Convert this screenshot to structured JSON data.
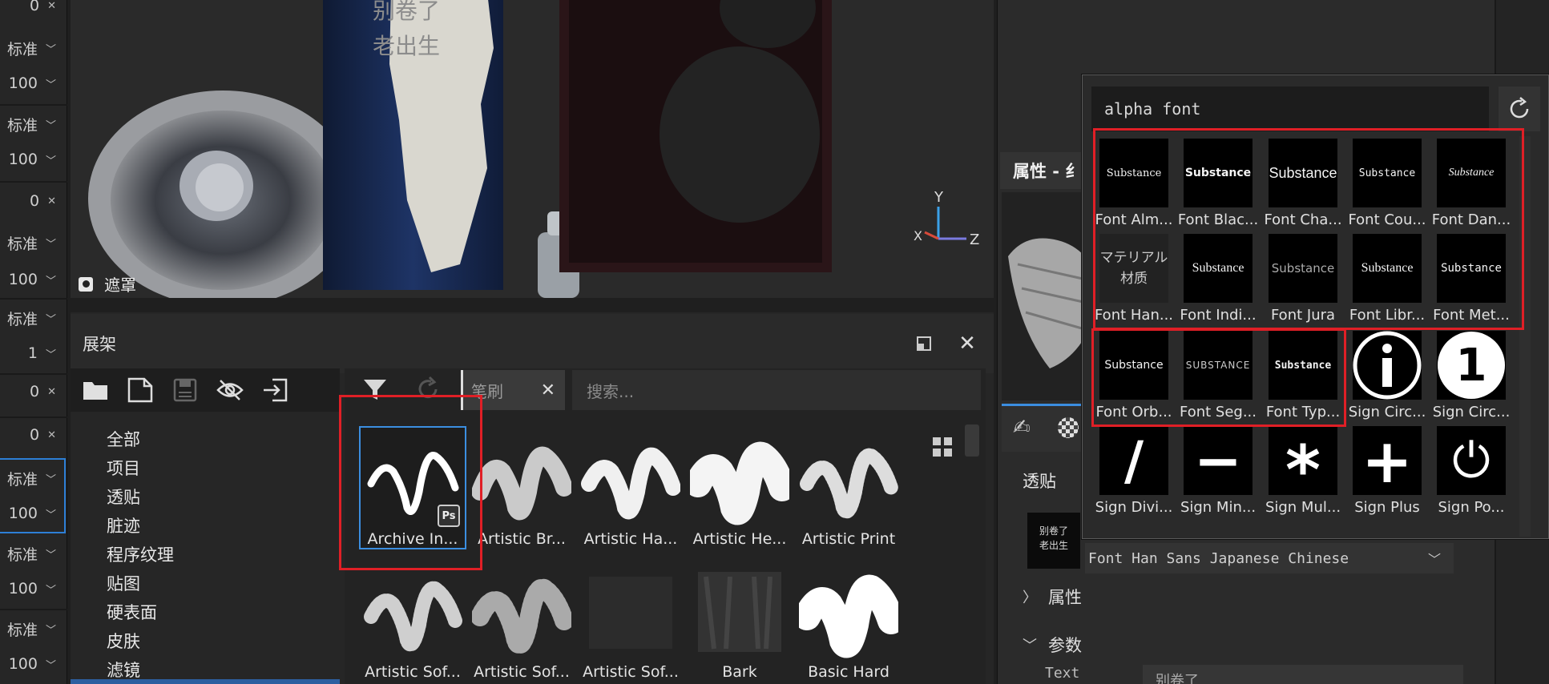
{
  "left_strip": {
    "rows": [
      {
        "text": "0",
        "type": "close"
      },
      {
        "text": "标准",
        "type": "dropdown"
      },
      {
        "text": "100",
        "type": "dropdown"
      },
      {
        "text": "标准",
        "type": "dropdown"
      },
      {
        "text": "100",
        "type": "dropdown"
      },
      {
        "text": "0",
        "type": "close"
      },
      {
        "text": "标准",
        "type": "dropdown"
      },
      {
        "text": "100",
        "type": "dropdown"
      },
      {
        "text": "标准",
        "type": "dropdown"
      },
      {
        "text": "1",
        "type": "dropdown"
      },
      {
        "text": "0",
        "type": "close"
      },
      {
        "text": "0",
        "type": "close"
      },
      {
        "text": "标准",
        "type": "dropdown"
      },
      {
        "text": "100",
        "type": "dropdown"
      },
      {
        "text": "标准",
        "type": "dropdown"
      },
      {
        "text": "100",
        "type": "dropdown"
      },
      {
        "text": "标准",
        "type": "dropdown"
      },
      {
        "text": "100",
        "type": "dropdown"
      }
    ]
  },
  "viewport": {
    "mask_label": "遮罩",
    "can_text": "别卷了\n老出生",
    "axes": {
      "y": "Y",
      "x": "X",
      "z": "Z"
    }
  },
  "shelf": {
    "title": "展架",
    "filter_tag": "笔刷",
    "search_placeholder": "搜索...",
    "categories": [
      "全部",
      "项目",
      "透贴",
      "脏迹",
      "程序纹理",
      "贴图",
      "硬表面",
      "皮肤",
      "滤镜"
    ],
    "brushes": [
      "Archive In...",
      "Artistic Br...",
      "Artistic Ha...",
      "Artistic He...",
      "Artistic Print",
      "Artistic Sof...",
      "Artistic Sof...",
      "Artistic Sof...",
      "Bark",
      "Basic Hard"
    ],
    "ps_badge": "Ps"
  },
  "properties": {
    "title": "属性 - 纟",
    "decal_section": "透贴",
    "decal_thumb_text": "别卷了\n老出生",
    "font_value": "Font Han Sans Japanese Chinese",
    "attributes_section": "属性",
    "params_section": "参数",
    "text_label": "Text",
    "text_value": "别卷了"
  },
  "picker": {
    "search_value": "alpha font",
    "items": [
      {
        "label": "Font Alm...",
        "preview": "Substance"
      },
      {
        "label": "Font Blac...",
        "preview": "Substance"
      },
      {
        "label": "Font Cha...",
        "preview": "Substance"
      },
      {
        "label": "Font Cou...",
        "preview": "Substance"
      },
      {
        "label": "Font Dan...",
        "preview": "Substance"
      },
      {
        "label": "Font Han...",
        "preview": "マテリアル\n材质"
      },
      {
        "label": "Font Indi...",
        "preview": "Substance"
      },
      {
        "label": "Font Jura",
        "preview": "Substance"
      },
      {
        "label": "Font Libr...",
        "preview": "Substance"
      },
      {
        "label": "Font Met...",
        "preview": "Substance"
      },
      {
        "label": "Font Orb...",
        "preview": "Substance"
      },
      {
        "label": "Font Seg...",
        "preview": "SUBSTANCE"
      },
      {
        "label": "Font Typ...",
        "preview": "Substance"
      },
      {
        "label": "Sign Circ...",
        "preview": "i"
      },
      {
        "label": "Sign Circ...",
        "preview": "1"
      },
      {
        "label": "Sign Divi...",
        "preview": "/"
      },
      {
        "label": "Sign Min...",
        "preview": "−"
      },
      {
        "label": "Sign Mul...",
        "preview": "*"
      },
      {
        "label": "Sign Plus",
        "preview": "+"
      },
      {
        "label": "Sign Po...",
        "preview": "⏻"
      }
    ]
  },
  "colors": {
    "highlight": "#e01f26",
    "accent": "#3b8ee0"
  }
}
